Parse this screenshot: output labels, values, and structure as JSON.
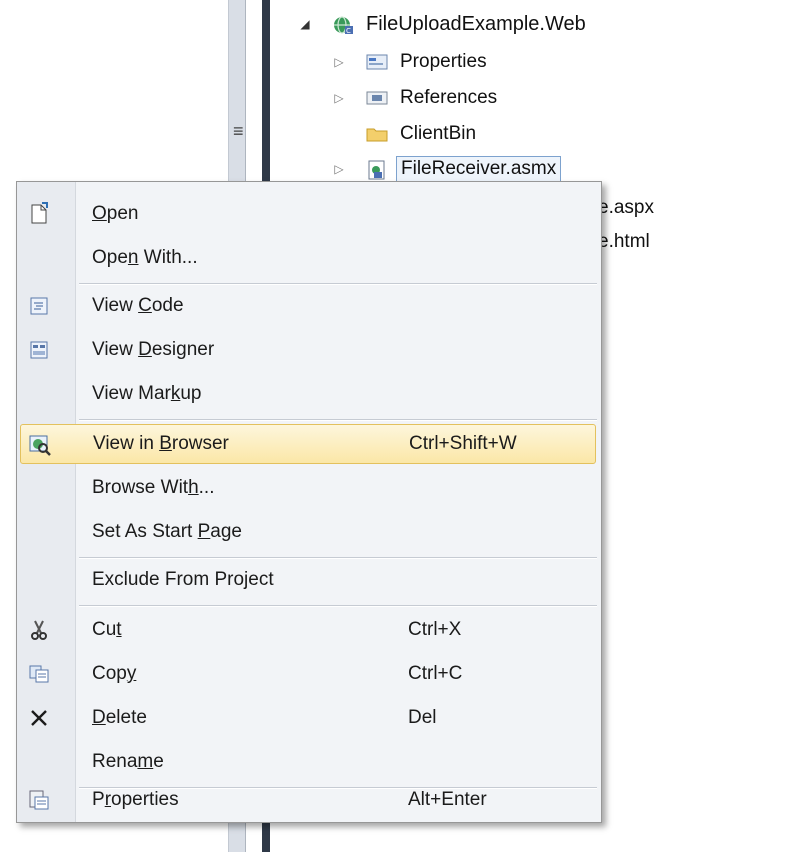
{
  "tree": {
    "project": "FileUploadExample.Web",
    "items": [
      {
        "label": "Properties",
        "icon": "properties-icon",
        "expander": "▷"
      },
      {
        "label": "References",
        "icon": "references-icon",
        "expander": "▷"
      },
      {
        "label": "ClientBin",
        "icon": "folder-icon",
        "expander": ""
      },
      {
        "label": "FileReceiver.asmx",
        "icon": "asmx-file-icon",
        "expander": "▷"
      },
      {
        "label": "pleTestPage.aspx",
        "icon": "",
        "expander": ""
      },
      {
        "label": "pleTestPage.html",
        "icon": "",
        "expander": ""
      }
    ]
  },
  "menu": {
    "items": [
      {
        "pre": "",
        "key": "O",
        "post": "pen",
        "shortcut": "",
        "icon": "open-icon"
      },
      {
        "pre": "Ope",
        "key": "n",
        "post": " With...",
        "shortcut": "",
        "icon": ""
      },
      {
        "pre": "View ",
        "key": "C",
        "post": "ode",
        "shortcut": "",
        "icon": "view-code-icon"
      },
      {
        "pre": "View ",
        "key": "D",
        "post": "esigner",
        "shortcut": "",
        "icon": "view-designer-icon"
      },
      {
        "pre": "View Mar",
        "key": "k",
        "post": "up",
        "shortcut": "",
        "icon": ""
      },
      {
        "pre": "View in ",
        "key": "B",
        "post": "rowser",
        "shortcut": "Ctrl+Shift+W",
        "icon": "view-in-browser-icon"
      },
      {
        "pre": "Browse Wit",
        "key": "h",
        "post": "...",
        "shortcut": "",
        "icon": ""
      },
      {
        "pre": "Set As Start ",
        "key": "P",
        "post": "age",
        "shortcut": "",
        "icon": ""
      },
      {
        "pre": "Exclude From Pro",
        "key": "j",
        "post": "ect",
        "shortcut": "",
        "icon": ""
      },
      {
        "pre": "Cu",
        "key": "t",
        "post": "",
        "shortcut": "Ctrl+X",
        "icon": "cut-icon"
      },
      {
        "pre": "Cop",
        "key": "y",
        "post": "",
        "shortcut": "Ctrl+C",
        "icon": "copy-icon"
      },
      {
        "pre": "",
        "key": "D",
        "post": "elete",
        "shortcut": "Del",
        "icon": "delete-icon"
      },
      {
        "pre": "Rena",
        "key": "m",
        "post": "e",
        "shortcut": "",
        "icon": ""
      },
      {
        "pre": "P",
        "key": "r",
        "post": "operties",
        "shortcut": "Alt+Enter",
        "icon": "properties-icon"
      }
    ]
  }
}
